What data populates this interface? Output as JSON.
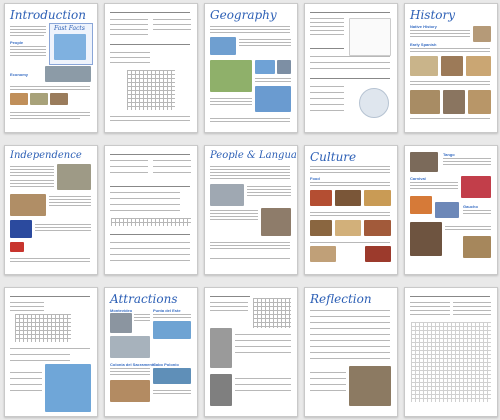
{
  "pages": [
    {
      "title": "Introduction",
      "subtitle": ""
    },
    {
      "title": "",
      "subtitle": ""
    },
    {
      "title": "Geography",
      "subtitle": ""
    },
    {
      "title": "",
      "subtitle": ""
    },
    {
      "title": "History",
      "subtitle": ""
    },
    {
      "title": "Independence",
      "subtitle": ""
    },
    {
      "title": "",
      "subtitle": ""
    },
    {
      "title": "People & Language",
      "subtitle": ""
    },
    {
      "title": "Culture",
      "subtitle": ""
    },
    {
      "title": "",
      "subtitle": ""
    },
    {
      "title": "",
      "subtitle": ""
    },
    {
      "title": "Attractions",
      "subtitle": ""
    },
    {
      "title": "",
      "subtitle": ""
    },
    {
      "title": "Reflection",
      "subtitle": ""
    },
    {
      "title": "",
      "subtitle": ""
    }
  ],
  "labels": {
    "fast_facts": "Fast Facts",
    "intro_people": "People",
    "intro_economy": "Economy",
    "history_sub1": "Native History",
    "history_sub2": "Early Spanish",
    "culture_food": "Food",
    "culture_carnival": "Carnival",
    "attr_montevideo": "Montevideo",
    "attr_punta": "Punta del Este",
    "attr_colonia": "Colonia del Sacramento",
    "attr_cabo": "Cabo Polonio",
    "culture_gaucho": "Gaucho",
    "culture_tango": "Tango"
  }
}
